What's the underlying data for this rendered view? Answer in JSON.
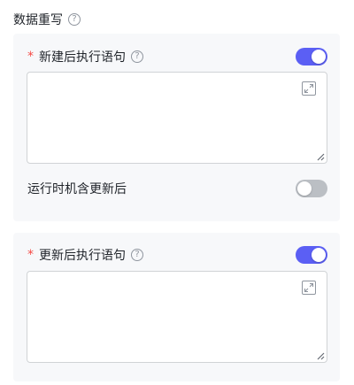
{
  "section": {
    "title": "数据重写"
  },
  "create_statement": {
    "label": "新建后执行语句",
    "value": "",
    "enabled": true
  },
  "run_on_update": {
    "label": "运行时机含更新后",
    "enabled": false
  },
  "update_statement": {
    "label": "更新后执行语句",
    "value": "",
    "enabled": true
  },
  "icons": {
    "help": "help-icon",
    "expand": "expand-icon",
    "resize": "resize-handle-icon"
  },
  "colors": {
    "accent": "#5b5ff4",
    "required": "#f54a45",
    "switch_off": "#bbbfc4",
    "card_bg": "#f7f8fa"
  },
  "glyphs": {
    "help": "?",
    "required": "*"
  }
}
